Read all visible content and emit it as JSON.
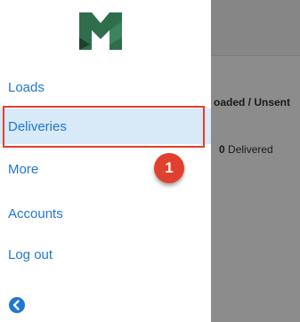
{
  "drawer": {
    "items": [
      {
        "label": "Loads"
      },
      {
        "label": "Deliveries"
      },
      {
        "label": "More"
      },
      {
        "label": "Accounts"
      },
      {
        "label": "Log out"
      }
    ]
  },
  "badge": {
    "step": "1"
  },
  "background_content": {
    "title": "oaded / Unsent",
    "count": "0",
    "count_label": "Delivered"
  },
  "colors": {
    "accent": "#1f77d0",
    "selected_bg": "#d8e9f8",
    "highlight": "#e53e2f",
    "logo_green": "#2f6e4c"
  },
  "icons": {
    "logo": "mm-logo-icon",
    "back": "back-arrow-circle-icon"
  }
}
